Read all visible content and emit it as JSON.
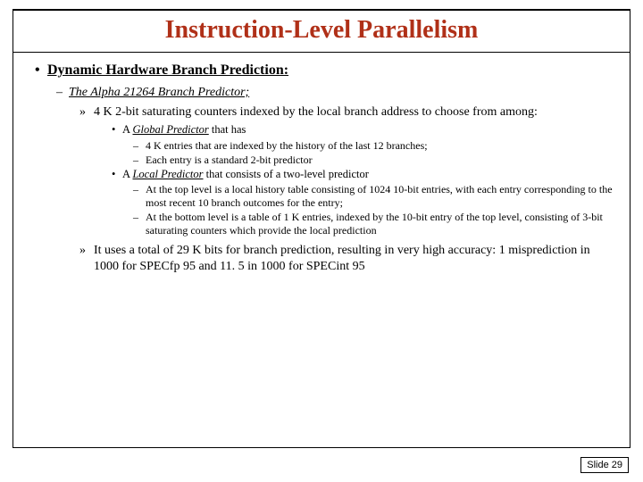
{
  "title": "Instruction-Level Parallelism",
  "bullet1": "Dynamic Hardware Branch Prediction:",
  "bullet2": "The Alpha 21264 Branch Predictor;",
  "bullet3a": "4 K 2-bit saturating counters indexed by the local branch address to choose from among:",
  "global_label": "Global Predictor",
  "global_prefix": "A ",
  "global_suffix": " that has",
  "global_s1": "4 K entries that are indexed by the history of the last 12 branches;",
  "global_s2": "Each entry is a standard 2-bit predictor",
  "local_label": "Local Predictor",
  "local_prefix": "A ",
  "local_suffix": " that consists of a two-level predictor",
  "local_s1": "At the top level is a local history table consisting of 1024 10-bit entries, with each entry corresponding to the most recent 10 branch outcomes for the entry;",
  "local_s2": "At the bottom level is a table of 1 K entries, indexed by the 10-bit entry of the top level, consisting of 3-bit saturating counters which provide the local prediction",
  "bullet3b": "It uses a total of 29 K bits for branch prediction, resulting in very high accuracy: 1 misprediction in 1000 for SPECfp 95 and 11. 5 in 1000 for SPECint 95",
  "slide_num": "Slide 29"
}
